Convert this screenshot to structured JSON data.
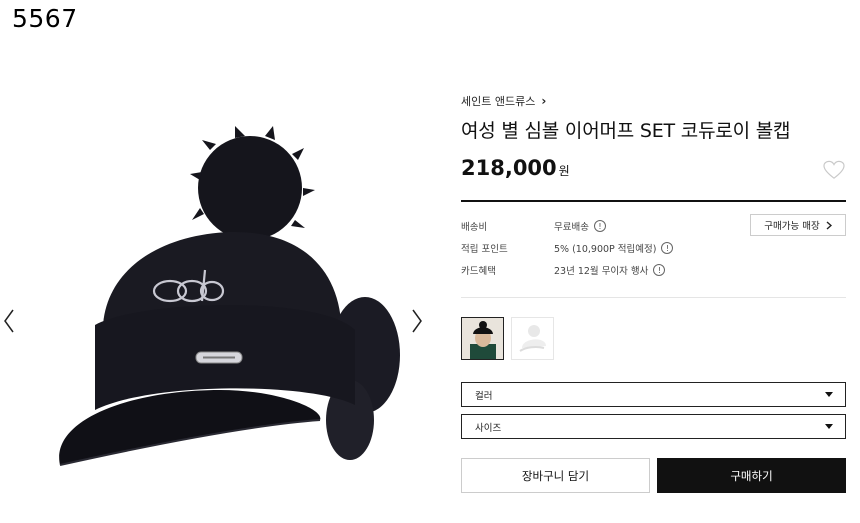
{
  "product_id": "5567",
  "brand": {
    "name": "세인트 앤드류스",
    "chevron": "›"
  },
  "product": {
    "title": "여성 별 심볼 이어머프 SET 코듀로이 볼캡",
    "price": "218,000",
    "currency": "원"
  },
  "info": {
    "shipping": {
      "label": "배송비",
      "value": "무료배송"
    },
    "points": {
      "label": "적립 포인트",
      "value": "5% (10,900P 적립예정)"
    },
    "card": {
      "label": "카드혜택",
      "value": "23년 12월 무이자 행사"
    },
    "store_button": "구매가능 매장"
  },
  "options": {
    "color": "컬러",
    "size": "사이즈"
  },
  "actions": {
    "cart": "장바구니 담기",
    "buy": "구매하기"
  },
  "icons": [
    "chevron-left-icon",
    "chevron-right-icon",
    "heart-icon",
    "info-icon",
    "caret-down-icon"
  ],
  "colors": {
    "accent": "#111111",
    "border": "#cccccc"
  }
}
